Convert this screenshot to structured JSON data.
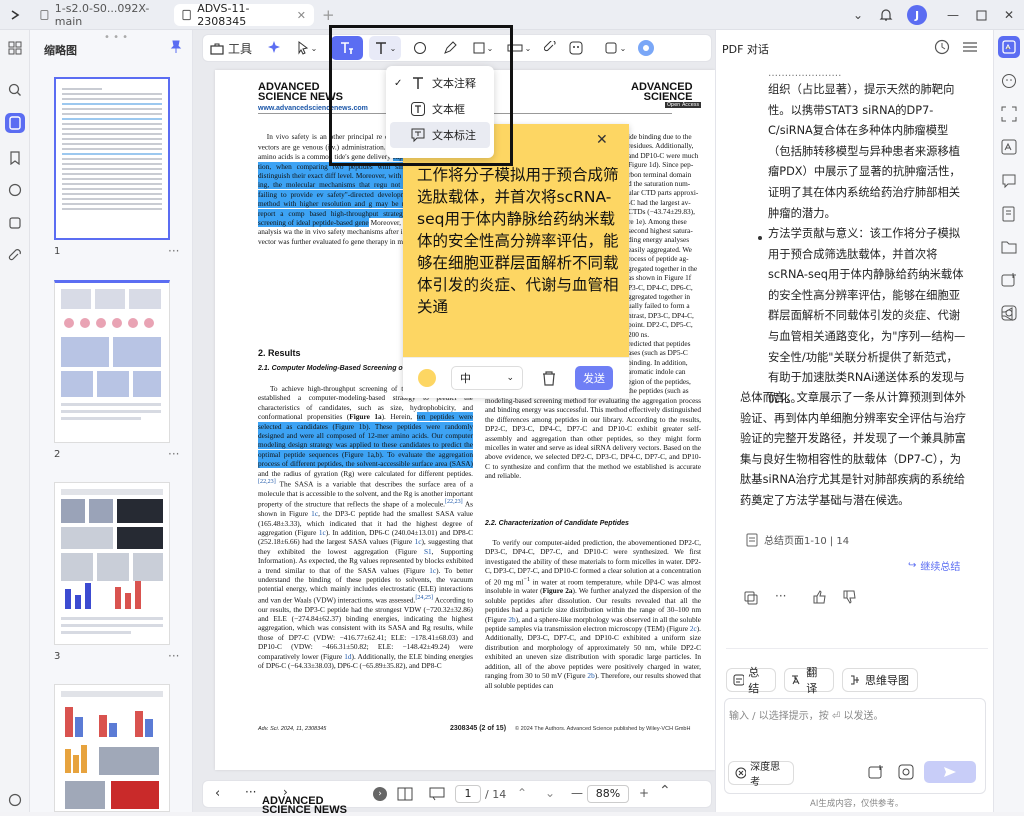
{
  "tabs": [
    {
      "label": "1-s2.0-S0...092X-main"
    },
    {
      "label": "ADVS-11-2308345"
    }
  ],
  "sidebar": {
    "title": "缩略图",
    "pages": [
      "1",
      "2",
      "3"
    ]
  },
  "toolbar": {
    "tools_label": "工具"
  },
  "dropdown": {
    "items": [
      "文本注释",
      "文本框",
      "文本标注"
    ]
  },
  "document": {
    "header_logo_left": "ADVANCED\nSCIENCE NEWS",
    "header_url": "www.advancedsciencenews.com",
    "header_logo_right": "ADVANCED\nSCIENCE",
    "header_logo_right_sub": "Open Access",
    "section_title": "2. Results",
    "subsection1": "2.1. Computer Modeling-Based Screening of",
    "subsection2": "2.2. Characterization of Candidate Peptides",
    "footer_left": "Adv. Sci. 2024, 11, 2308345",
    "footer_mid": "2308345 (2 of 15)",
    "footer_right": "© 2024 The Authors. Advanced Science published by Wiley-VCH GmbH"
  },
  "note": {
    "text": "工作将分子模拟用于预合成筛选肽载体，并首次将scRNA-seq用于体内静脉给药纳米载体的安全性高分辨率评估，能够在细胞亚群层面解析不同载体引发的炎症、代谢与血管相关通",
    "font_size": "中",
    "send": "发送"
  },
  "bottombar": {
    "page": "1",
    "total": "/ 14",
    "zoom": "88%"
  },
  "chat": {
    "title": "PDF 对话",
    "para1": "组织（占比显著），提示天然的肺靶向性。以携带STAT3 siRNA的DP7-C/siRNA复合体在多种体内肺瘤模型（包括肺转移模型与异种患者来源移植瘤PDX）中展示了显著的抗肿瘤活性，证明了其在体内系统给药治疗肺部相关肿瘤的潜力。",
    "bullet": "方法学贡献与意义：该工作将分子模拟用于预合成筛选肽载体，并首次将scRNA-seq用于体内静脉给药纳米载体的安全性高分辨率评估，能够在细胞亚群层面解析不同载体引发的炎症、代谢与血管相关通路变化，为\"序列—结构—安全性/功能\"关联分析提供了新范式，有助于加速肽类RNAi递送体系的发现与优化。",
    "para2": "总体而言，文章展示了一条从计算预测到体外验证、再到体内单细胞分辨率安全评估与治疗验证的完整开发路径，并发现了一个兼具肺富集与良好生物相容性的肽载体（DP7-C），为肽基siRNA治疗尤其是针对肺部疾病的系统给药奠定了方法学基础与潜在候选。",
    "summary_pages": "总结页面1-10 | 14",
    "continue": "继续总结",
    "btn_summary": "总结",
    "btn_translate": "翻译",
    "btn_mindmap": "思维导图",
    "input_placeholder": "输入 / 以选择提示，按 ⏎ 以发送。",
    "deep_think": "深度思考",
    "disclaimer": "AI生成内容，仅供参考。"
  },
  "colors": {
    "accent": "#5b6df2",
    "highlight": "#3da3f4",
    "note": "#fdd663"
  }
}
